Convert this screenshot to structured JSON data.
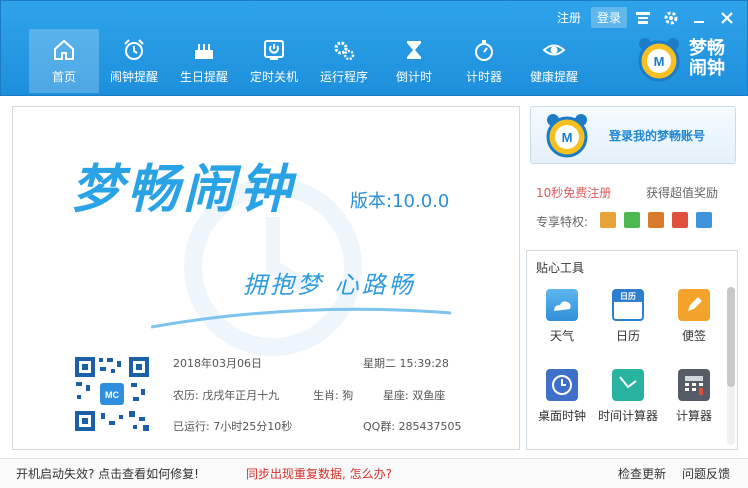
{
  "window": {
    "register": "注册",
    "login": "登录"
  },
  "nav": [
    {
      "label": "首页",
      "icon": "home-icon"
    },
    {
      "label": "闹钟提醒",
      "icon": "alarm-clock-icon"
    },
    {
      "label": "生日提醒",
      "icon": "birthday-cake-icon"
    },
    {
      "label": "定时关机",
      "icon": "power-icon"
    },
    {
      "label": "运行程序",
      "icon": "gears-icon"
    },
    {
      "label": "倒计时",
      "icon": "hourglass-icon"
    },
    {
      "label": "计时器",
      "icon": "stopwatch-icon"
    },
    {
      "label": "健康提醒",
      "icon": "eye-icon"
    }
  ],
  "brand": {
    "name": "梦畅闹钟"
  },
  "main": {
    "title": "梦畅闹钟",
    "version": "版本:10.0.0",
    "slogan": "拥抱梦 心路畅",
    "qr_label": "MC",
    "date": "2018年03月06日",
    "weekday_time": "星期二 15:39:28",
    "lunar": "农历: 戊戌年正月十九",
    "zodiac": "生肖: 狗",
    "constellation": "星座: 双鱼座",
    "uptime": "已运行: 7小时25分10秒",
    "qq_group": "QQ群: 285437505"
  },
  "account": {
    "login_label": "登录我的梦畅账号",
    "register_promo": "10秒免费注册",
    "reward": "获得超值奖励",
    "privilege_label": "专享特权:"
  },
  "tools": {
    "title": "贴心工具",
    "items": [
      {
        "label": "天气",
        "icon": "weather-icon"
      },
      {
        "label": "日历",
        "icon": "calendar-icon",
        "badge": "日历"
      },
      {
        "label": "便签",
        "icon": "note-pencil-icon"
      },
      {
        "label": "桌面时钟",
        "icon": "desktop-clock-icon"
      },
      {
        "label": "时间计算器",
        "icon": "time-calculator-icon"
      },
      {
        "label": "计算器",
        "icon": "calculator-icon"
      }
    ]
  },
  "footer": {
    "boot_fix": "开机启动失效? 点击查看如何修复!",
    "sync_issue": "同步出现重复数据, 怎么办?",
    "check_update": "检查更新",
    "feedback": "问题反馈"
  },
  "colors": {
    "header_blue": "#1d8fdc",
    "accent_red": "#d8302a",
    "link_blue": "#1f86d4"
  }
}
